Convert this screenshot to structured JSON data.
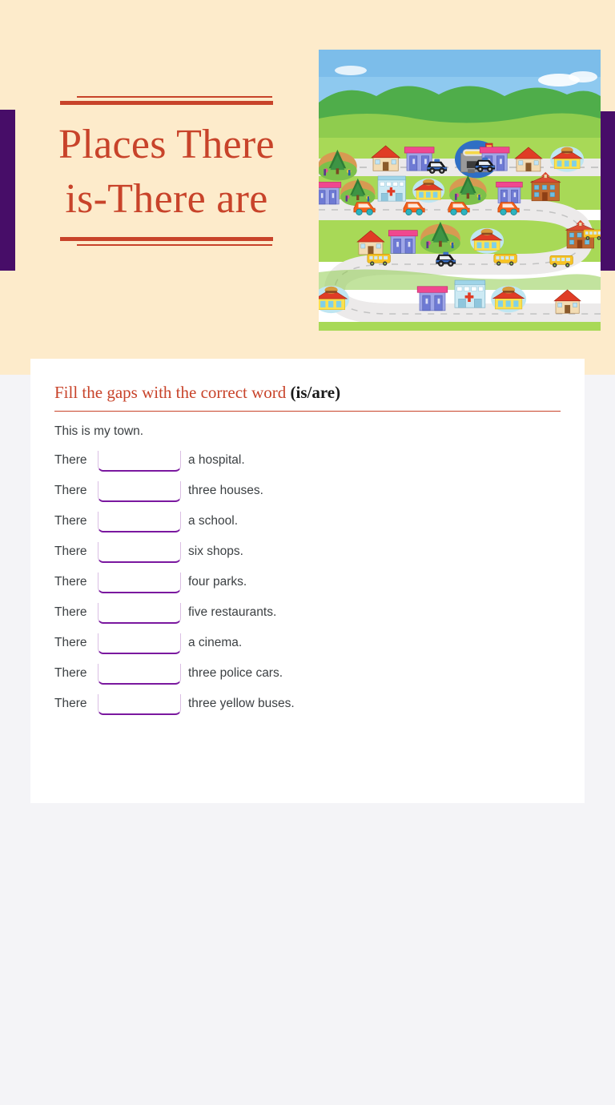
{
  "theme": {
    "header_bg": "#fdebcb",
    "page_bg": "#f4f4f7",
    "accent_red": "#c8432a",
    "accent_purple": "#470d68",
    "blank_underline": "#7a189f",
    "card_bg": "#ffffff",
    "body_text": "#3c4043"
  },
  "header": {
    "title": "Places There is-There are",
    "title_line_1": "Places There",
    "title_line_2": "is-There are"
  },
  "illustration": {
    "alt": "Cartoon town collage with houses, shops, school, hospital, cinema, restaurants, parks, cars, police cars and yellow school buses along winding roads",
    "sky_color": "#8ec9ef",
    "hill_color": "#4fad4a",
    "grass_color": "#a8d957",
    "road_color": "#eceaea",
    "car_color": "#f4611a",
    "bus_color": "#f7c325"
  },
  "worksheet": {
    "instruction_normal": "Fill the gaps with the correct word ",
    "instruction_bold": "(is/are)",
    "intro": "This is my town.",
    "questions": [
      {
        "pre": "There",
        "blank_value": "",
        "post": "a hospital."
      },
      {
        "pre": "There",
        "blank_value": "",
        "post": "three houses."
      },
      {
        "pre": "There",
        "blank_value": "",
        "post": "a school."
      },
      {
        "pre": "There",
        "blank_value": "",
        "post": "six shops."
      },
      {
        "pre": "There",
        "blank_value": "",
        "post": "four parks."
      },
      {
        "pre": "There",
        "blank_value": "",
        "post": "five restaurants."
      },
      {
        "pre": "There",
        "blank_value": "",
        "post": "a cinema."
      },
      {
        "pre": "There",
        "blank_value": "",
        "post": "three police cars."
      },
      {
        "pre": "There",
        "blank_value": "",
        "post": "three yellow buses."
      }
    ]
  }
}
